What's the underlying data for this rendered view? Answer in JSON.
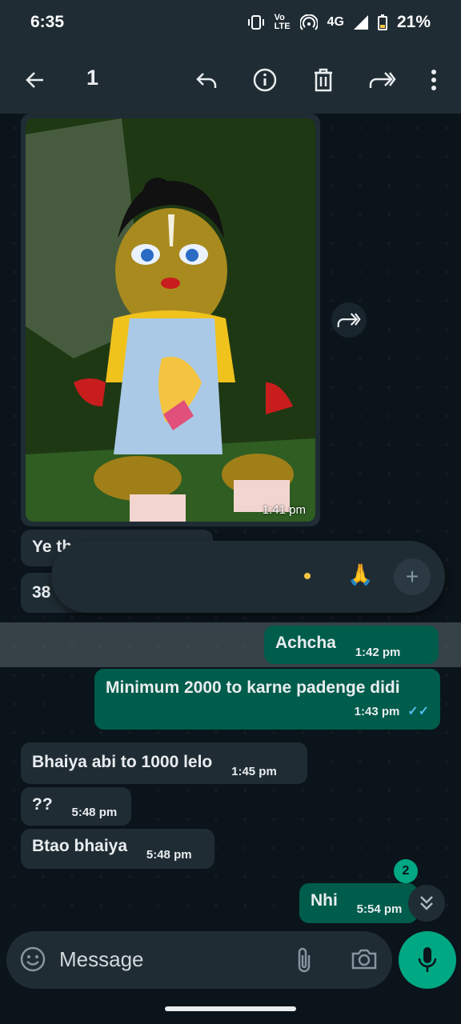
{
  "status_bar": {
    "time": "6:35",
    "network": "4G",
    "volte": "Vo LTE",
    "battery": "21%"
  },
  "app_bar": {
    "selected_count": "1",
    "icons": [
      "back-arrow-icon",
      "reply-icon",
      "info-icon",
      "delete-icon",
      "forward-icon",
      "more-icon"
    ]
  },
  "image_message": {
    "time": "1:41 pm"
  },
  "messages": [
    {
      "dir": "in",
      "text": "Ye th",
      "time": ""
    },
    {
      "dir": "in",
      "text": "38",
      "time": ""
    },
    {
      "dir": "out",
      "text": "Achcha",
      "time": "1:42 pm"
    },
    {
      "dir": "out",
      "text": "Minimum 2000 to karne padenge didi",
      "time": "1:43 pm"
    },
    {
      "dir": "in",
      "text": "Bhaiya abi to 1000 lelo",
      "time": "1:45 pm"
    },
    {
      "dir": "in",
      "text": "??",
      "time": "5:48 pm"
    },
    {
      "dir": "in",
      "text": "Btao bhaiya",
      "time": "5:48 pm"
    },
    {
      "dir": "out",
      "text": "Nhi",
      "time": "5:54 pm"
    }
  ],
  "reaction_bar": {
    "pray": "🙏",
    "plus": "+"
  },
  "unread_badge": "2",
  "input": {
    "placeholder": "Message"
  },
  "colors": {
    "background": "#0b141a",
    "incoming": "#1f2c34",
    "outgoing": "#005c4b",
    "accent": "#00a884",
    "read_ticks": "#53bdeb"
  }
}
